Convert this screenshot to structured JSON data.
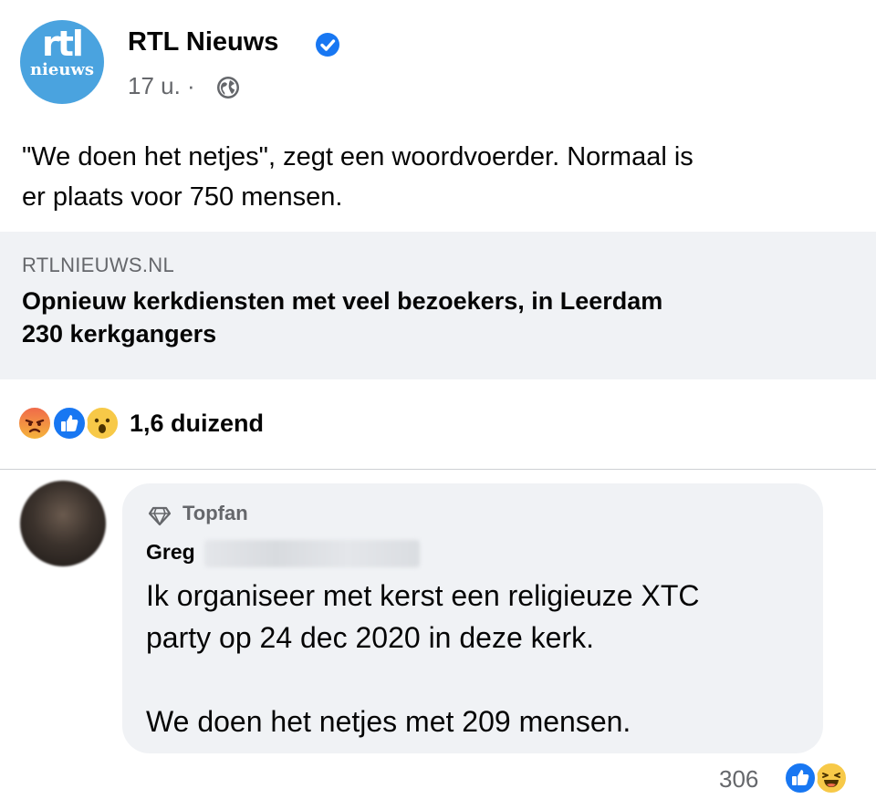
{
  "post": {
    "page_name": "RTL Nieuws",
    "logo_text_top": "rtl",
    "logo_text_bottom": "nieuws",
    "time": "17 u. ·",
    "verified_icon": "verified-badge-icon",
    "privacy_icon": "globe-icon",
    "text_line1": "\"We doen het netjes\", zegt een woordvoerder. Normaal is",
    "text_line2": "er plaats voor 750 mensen."
  },
  "link_preview": {
    "domain": "RTLNIEUWS.NL",
    "title_line1": "Opnieuw kerkdiensten met veel bezoekers, in Leerdam",
    "title_line2": "230 kerkgangers"
  },
  "reactions": {
    "icons": [
      "angry-reaction-icon",
      "like-reaction-icon",
      "wow-reaction-icon"
    ],
    "count": "1,6 duizend"
  },
  "comment": {
    "badge_icon": "diamond-icon",
    "badge_label": "Topfan",
    "author": "Greg",
    "line1": "Ik organiseer met kerst een religieuze XTC",
    "line2": "party op 24 dec 2020 in deze kerk.",
    "line3": "We doen het netjes met 209 mensen.",
    "reaction_count": "306",
    "reaction_icons": [
      "like-reaction-icon",
      "haha-reaction-icon"
    ]
  },
  "colors": {
    "brand_blue": "#1877f2",
    "logo_blue": "#4aa3df",
    "secondary_text": "#65676b",
    "card_bg": "#f0f2f5"
  }
}
